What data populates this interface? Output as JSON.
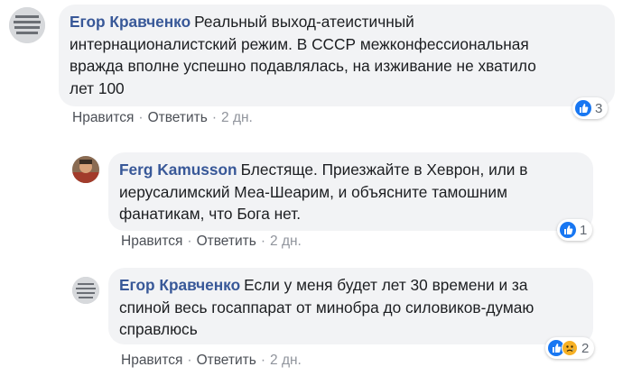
{
  "comments": [
    {
      "author": "Егор Кравченко",
      "text": "Реальный выход-атеистичный\nинтернационалистский режим. В СССР межконфессиональная\nвражда вполне успешно подавлялась, на изживание не хватило\nлет 100",
      "like_label": "Нравится",
      "reply_label": "Ответить",
      "time": "2 дн.",
      "reaction_count": "3",
      "reactions": [
        "like-icon"
      ]
    },
    {
      "author": "Ferg Kamusson",
      "text": "Блестяще. Приезжайте в Хеврон, или в\nиерусалимский Меа-Шеарим, и объясните тамошним\nфанатикам, что Бога нет.",
      "like_label": "Нравится",
      "reply_label": "Ответить",
      "time": "2 дн.",
      "reaction_count": "1",
      "reactions": [
        "like-icon"
      ]
    },
    {
      "author": "Егор Кравченко",
      "text": "Если у меня будет лет 30 времени и за\nспиной весь госаппарат от минобра до силовиков-думаю\nсправлюсь",
      "like_label": "Нравится",
      "reply_label": "Ответить",
      "time": "2 дн.",
      "reaction_count": "2",
      "reactions": [
        "like-icon",
        "sad-icon"
      ]
    }
  ],
  "colors": {
    "author_link": "#385898",
    "bubble_bg": "#f2f3f5",
    "like_blue": "#1877f2",
    "sad_yellow": "#f7b125"
  }
}
